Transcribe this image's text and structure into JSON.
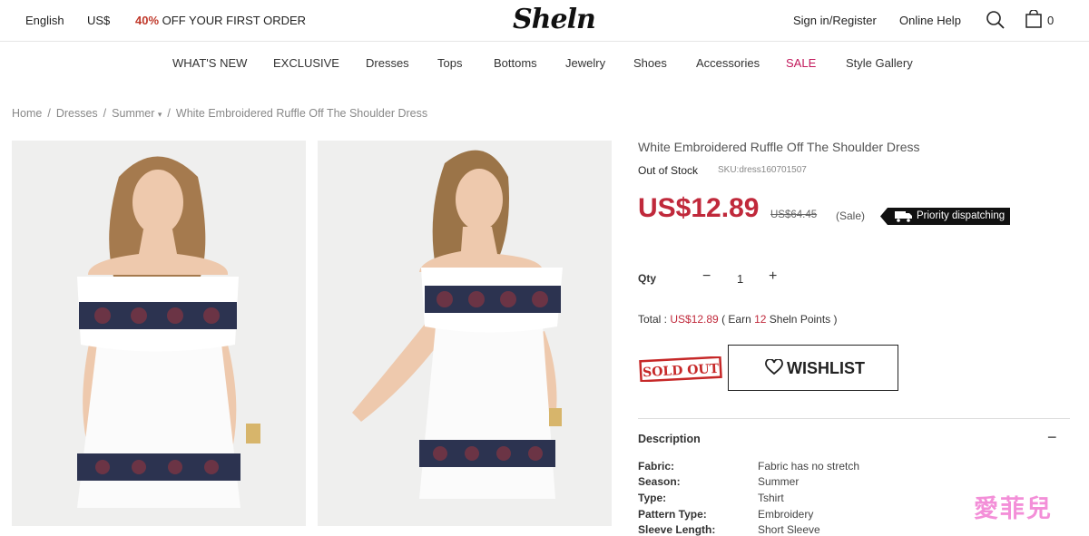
{
  "topbar": {
    "language": "English",
    "currency": "US$",
    "promo_highlight": "40%",
    "promo_text": " OFF YOUR FIRST ORDER",
    "logo": "Sheln",
    "signin": "Sign in/Register",
    "help": "Online Help",
    "cart_count": "0"
  },
  "nav": {
    "items": [
      "WHAT'S NEW",
      "EXCLUSIVE",
      "Dresses",
      "Tops",
      "Bottoms",
      "Jewelry",
      "Shoes",
      "Accessories",
      "SALE",
      "Style Gallery"
    ]
  },
  "breadcrumb": {
    "items": [
      "Home",
      "Dresses",
      "Summer",
      "White Embroidered Ruffle Off The Shoulder Dress"
    ],
    "caret": "▾"
  },
  "product": {
    "title": "White Embroidered Ruffle Off The Shoulder Dress",
    "stock": "Out of Stock",
    "sku": "SKU:dress160701507",
    "price": "US$12.89",
    "old_price": "US$64.45",
    "sale_tag": "(Sale)",
    "priority": "Priority dispatching",
    "qty_label": "Qty",
    "qty_minus": "−",
    "qty_value": "1",
    "qty_plus": "+",
    "total_label": "Total : ",
    "total_value": "US$12.89",
    "total_earn_pre": " ( Earn ",
    "total_points": "12",
    "total_earn_post": " Sheln Points )",
    "sold_out": "SOLD OUT",
    "wishlist": "WISHLIST"
  },
  "description": {
    "title": "Description",
    "toggle": "−",
    "attributes": [
      {
        "key": "Fabric:",
        "value": "Fabric has no stretch"
      },
      {
        "key": "Season:",
        "value": "Summer"
      },
      {
        "key": "Type:",
        "value": "Tshirt"
      },
      {
        "key": "Pattern Type:",
        "value": "Embroidery"
      },
      {
        "key": "Sleeve Length:",
        "value": "Short Sleeve"
      }
    ]
  },
  "watermark": "愛菲兒",
  "colors": {
    "price_red": "#c0293b",
    "sale_pink": "#c2185b",
    "watermark_pink": "#f06acb"
  }
}
